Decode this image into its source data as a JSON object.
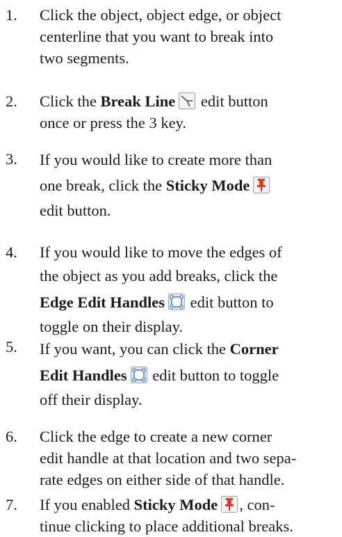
{
  "steps": [
    {
      "number": "1.",
      "lines": [
        "Click the object, object edge, or object",
        "centerline that you want to break into",
        "two segments."
      ]
    },
    {
      "number": "2.",
      "l1_before": "Click the",
      "l1_bold": "Break Line",
      "l1_after": "edit button",
      "l2": "once or press the 3 key."
    },
    {
      "number": "3.",
      "l1": "If you would like to create more than",
      "l2_before": "one break, click the",
      "l2_bold": "Sticky Mode",
      "l3": "edit button."
    },
    {
      "number": "4.",
      "l1": "If you would like to move the edges of",
      "l2": "the object as you add breaks, click the",
      "l3_bold": "Edge Edit Handles",
      "l3_after": "edit button to",
      "l4": "toggle on their display."
    },
    {
      "number": "5.",
      "l1_before": "If you want, you can click the",
      "l1_bold": "Corner",
      "l2_bold": "Edit Handles",
      "l2_after": "edit button to toggle",
      "l3": "off their display."
    },
    {
      "number": "6.",
      "lines": [
        "Click the edge to create a new corner",
        "edit handle at that location and two sepa-",
        "rate edges on either side of that handle."
      ]
    },
    {
      "number": "7.",
      "l1_before": "If you enabled",
      "l1_bold": "Sticky Mode",
      "l1_after": ", con-",
      "l2": "tinue clicking to place additional breaks."
    }
  ],
  "icons": {
    "break_line": "break-line-icon",
    "sticky_mode": "pushpin-icon",
    "edit_handles": "edit-handles-icon"
  },
  "colors": {
    "text": "#1a1a1a",
    "pin_red": "#e0392b",
    "handle_blue": "#3a6fb0"
  }
}
